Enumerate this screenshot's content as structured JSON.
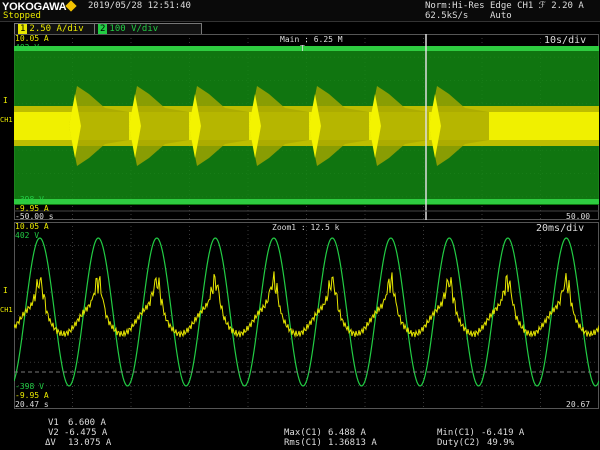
{
  "header": {
    "brand": "YOKOGAWA",
    "status": "Stopped",
    "datetime": "2019/05/28 12:51:40",
    "acq_mode": "Norm:Hi-Res",
    "sample_rate": "62.5kS/s",
    "trigger": "Edge CH1 ℱ 2.20 A",
    "trigger_mode": "Auto"
  },
  "channels": [
    {
      "num": "1",
      "scale": "2.50 A",
      "suffix": "/div",
      "color": "#e8e800"
    },
    {
      "num": "2",
      "scale": "100 V",
      "suffix": "/div",
      "color": "#22cc44"
    }
  ],
  "main_panel": {
    "title": "Main : 6.25 M",
    "timebase": "10s/div",
    "ch1_top": "10.05 A",
    "ch2_top": "402 V",
    "ch2_bottom": "-398 V",
    "ch1_bottom": "-9.95 A",
    "t_left": "-50.00 s",
    "t_right": "50.00 s",
    "trigger_marker": "T"
  },
  "zoom_panel": {
    "title": "Zoom1 : 12.5 k",
    "timebase": "20ms/div",
    "ch1_top": "10.05 A",
    "ch2_top": "402 V",
    "ch2_bottom": "-398 V",
    "ch1_bottom": "-9.95 A",
    "t_left": "20.47 s",
    "t_right": "20.67 s"
  },
  "side_labels": {
    "ground_marker": "I",
    "ch_label": "CH1"
  },
  "measurements": {
    "v1_label": "V1",
    "v1": "6.600 A",
    "v2_label": "V2",
    "v2": "-6.475 A",
    "dv_label": "ΔV",
    "dv": "13.075 A",
    "max_label": "Max(C1)",
    "max": "6.488 A",
    "rms_label": "Rms(C1)",
    "rms": "1.36813 A",
    "min_label": "Min(C1)",
    "min": "-6.419 A",
    "duty_label": "Duty(C2)",
    "duty": "49.9%"
  },
  "colors": {
    "ch1": "#e8e800",
    "ch2": "#22cc44",
    "grid": "#3a3a3a"
  }
}
